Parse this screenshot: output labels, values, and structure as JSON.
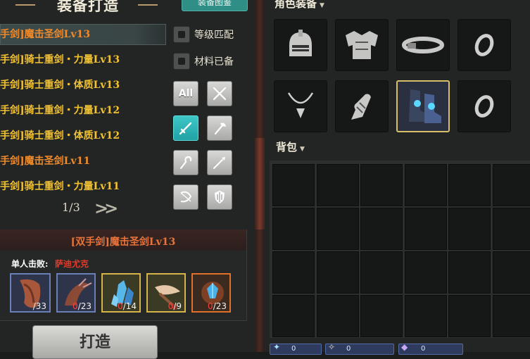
{
  "crafting": {
    "title": "装备打造",
    "catalog_button": "装备图鉴",
    "recipes": [
      {
        "label": "手剑]魔击圣剑Lv13",
        "color": "orange",
        "selected": true
      },
      {
        "label": "手剑]骑士重剑・力量Lv13",
        "color": "gold",
        "selected": false
      },
      {
        "label": "手剑]骑士重剑・体质Lv13",
        "color": "gold",
        "selected": false
      },
      {
        "label": "手剑]骑士重剑・力量Lv12",
        "color": "gold",
        "selected": false
      },
      {
        "label": "手剑]骑士重剑・体质Lv12",
        "color": "gold",
        "selected": false
      },
      {
        "label": "手剑]魔击圣剑Lv11",
        "color": "orange",
        "selected": false
      },
      {
        "label": "手剑]骑士重剑・力量Lv11",
        "color": "gold",
        "selected": false
      }
    ],
    "page": "1/3",
    "next_page_icon": "double-chevron-right-icon",
    "filters": {
      "level_match": "等级匹配",
      "materials_ready": "材料已备"
    },
    "weapon_filters": [
      {
        "name": "all",
        "label": "All",
        "active": false
      },
      {
        "name": "crossed-swords-icon",
        "active": false
      },
      {
        "name": "sword-icon",
        "active": true
      },
      {
        "name": "axe-icon",
        "active": false
      },
      {
        "name": "hook-icon",
        "active": false
      },
      {
        "name": "spear-icon",
        "active": false
      },
      {
        "name": "bow-icon",
        "active": false
      },
      {
        "name": "shield-icon",
        "active": false
      }
    ]
  },
  "detail": {
    "title": "[双手剑]魔击圣剑Lv13",
    "kill_label": "单人击败:",
    "kill_value": "萨迪尤克",
    "materials": [
      {
        "icon": "hide-scrap-icon",
        "have": "",
        "need": "/33",
        "rarity": "blue"
      },
      {
        "icon": "dragon-claw-icon",
        "have": "0",
        "need": "/23",
        "rarity": "blue"
      },
      {
        "icon": "blue-crystal-icon",
        "have": "0",
        "need": "/14",
        "rarity": "gold"
      },
      {
        "icon": "feather-icon",
        "have": "0",
        "need": "/9",
        "rarity": "gold"
      },
      {
        "icon": "blue-gem-icon",
        "have": "0",
        "need": "/23",
        "rarity": "orange"
      }
    ],
    "craft_button": "打造"
  },
  "equipment": {
    "title": "角色装备",
    "slots": [
      {
        "icon": "helmet-icon"
      },
      {
        "icon": "chest-armor-icon"
      },
      {
        "icon": "belt-icon"
      },
      {
        "icon": "ring-icon"
      },
      {
        "icon": "necklace-icon"
      },
      {
        "icon": "gauntlet-icon"
      },
      {
        "icon": "boots-icon",
        "selected": true
      },
      {
        "icon": "ring-icon"
      }
    ]
  },
  "bag": {
    "title": "背包",
    "slot_count": 24
  },
  "currencies": [
    {
      "icon": "crystal-currency-icon",
      "value": "0"
    },
    {
      "icon": "claw-currency-icon",
      "value": "0"
    },
    {
      "icon": "purple-gem-currency-icon",
      "value": "0"
    }
  ]
}
